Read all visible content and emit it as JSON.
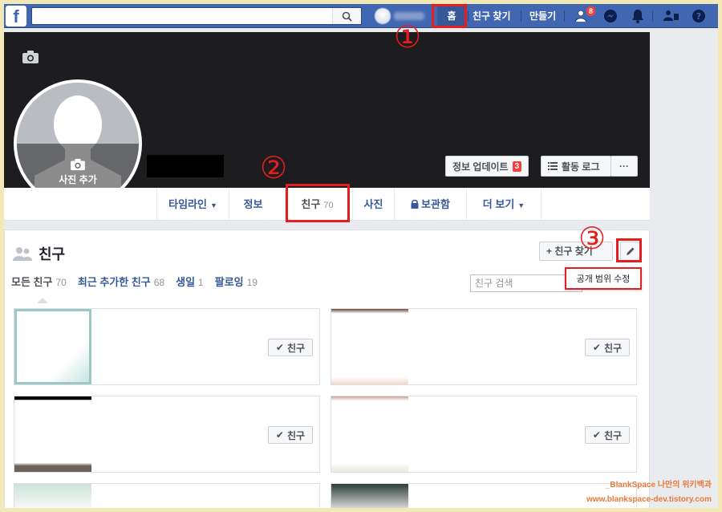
{
  "topbar": {
    "logo": "f",
    "home": "홈",
    "find_friends": "친구 찾기",
    "create": "만들기",
    "friend_requests_badge": "8"
  },
  "profile": {
    "add_photo": "사진 추가",
    "update_info": "정보 업데이트",
    "update_info_badge": "3",
    "activity_log": "활동 로그",
    "more": "···"
  },
  "tabs": [
    {
      "label": "타임라인"
    },
    {
      "label": "정보"
    },
    {
      "label": "친구",
      "count": "70"
    },
    {
      "label": "사진"
    },
    {
      "label": "보관함"
    },
    {
      "label": "더 보기"
    }
  ],
  "friends_panel": {
    "title": "친구",
    "find_button": "+ 친구 찾기",
    "subtabs": [
      {
        "label": "모든 친구",
        "count": "70"
      },
      {
        "label": "최근 추가한 친구",
        "count": "68"
      },
      {
        "label": "생일",
        "count": "1"
      },
      {
        "label": "팔로잉",
        "count": "19"
      }
    ],
    "search_placeholder": "친구 검색",
    "privacy_tooltip": "공개 범위 수정",
    "friend_button": "친구"
  },
  "annotations": {
    "n1": "①",
    "n2": "②",
    "n3": "③"
  },
  "watermark": {
    "line1": "_BlankSpace 나만의 위키백과",
    "line2": "www.blankspace-dev.tistory.com"
  },
  "colors": {
    "fb_blue": "#4267b2",
    "annotation_red": "#e41e1e",
    "link_blue": "#365899"
  }
}
